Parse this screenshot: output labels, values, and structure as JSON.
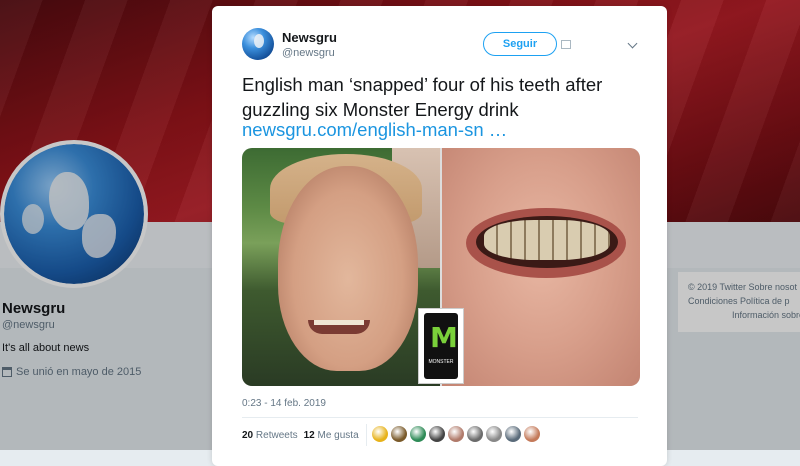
{
  "profile": {
    "name": "Newsgru",
    "handle": "@newsgru",
    "bio": "It's all about news",
    "joined": "Se unió en mayo de 2015"
  },
  "footer": {
    "line1": "© 2019 Twitter  Sobre nosot",
    "line2": "Condiciones   Política de p",
    "line3": "Información sobre"
  },
  "tweet": {
    "name": "Newsgru",
    "handle": "@newsgru",
    "follow_label": "Seguir",
    "text": "English man ‘snapped’ four of his teeth after guzzling six Monster Energy drink",
    "link": "newsgru.com/english-man-sn  …",
    "timestamp": "0:23 - 14 feb. 2019",
    "retweets_count": "20",
    "retweets_label": "Retweets",
    "likes_count": "12",
    "likes_label": "Me gusta",
    "can_text": "MONSTER"
  },
  "colors": {
    "accent": "#1da1f2",
    "link": "#1b95e0",
    "banner": "#a3161d"
  },
  "likers": [
    "#e7b21a",
    "#7a5a2a",
    "#2e8b57",
    "#444444",
    "#b07a6a",
    "#6b6b6b",
    "#888888",
    "#5a6b7a",
    "#c47a5a"
  ]
}
